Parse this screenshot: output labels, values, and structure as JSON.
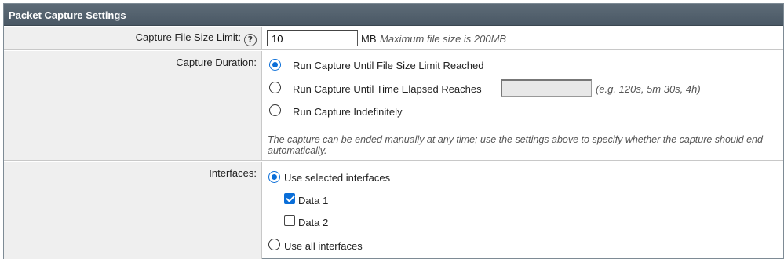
{
  "panel": {
    "title": "Packet Capture Settings"
  },
  "file_size": {
    "label": "Capture File Size Limit:",
    "value": "10",
    "unit": "MB",
    "hint": "Maximum file size is 200MB"
  },
  "duration": {
    "label": "Capture Duration:",
    "options": [
      {
        "label": "Run Capture Until File Size Limit Reached",
        "checked": true
      },
      {
        "label": "Run Capture Until Time Elapsed Reaches",
        "checked": false
      },
      {
        "label": "Run Capture Indefinitely",
        "checked": false
      }
    ],
    "time_value": "",
    "time_hint": "(e.g. 120s, 5m 30s, 4h)",
    "note": "The capture can be ended manually at any time; use the settings above to specify whether the capture should end automatically."
  },
  "interfaces": {
    "label": "Interfaces:",
    "selected_option": {
      "label": "Use selected interfaces",
      "checked": true
    },
    "items": [
      {
        "label": "Data 1",
        "checked": true
      },
      {
        "label": "Data 2",
        "checked": false
      }
    ],
    "all_option": {
      "label": "Use all interfaces",
      "checked": false
    }
  },
  "colors": {
    "accent": "#0a6ed8",
    "header": "#4a5865",
    "label_bg": "#efefef"
  }
}
